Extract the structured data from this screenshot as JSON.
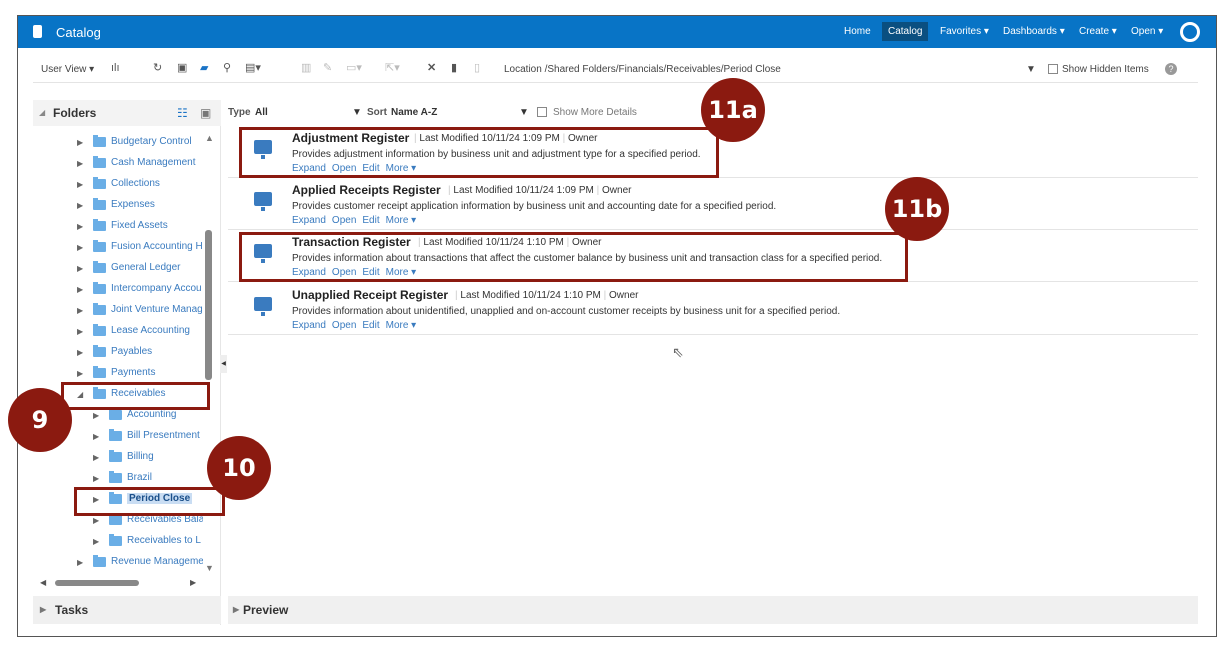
{
  "header": {
    "title": "Catalog",
    "nav": [
      "Home",
      "Catalog",
      "Favorites ▾",
      "Dashboards ▾",
      "Create ▾",
      "Open ▾"
    ],
    "active": "Catalog"
  },
  "toolbar": {
    "user_view": "User View ▾",
    "location": "Location /Shared Folders/Financials/Receivables/Period Close",
    "show_hidden": "Show Hidden Items"
  },
  "folders": {
    "title": "Folders",
    "items": [
      {
        "label": "Budgetary Control",
        "level": 1
      },
      {
        "label": "Cash Management",
        "level": 1
      },
      {
        "label": "Collections",
        "level": 1
      },
      {
        "label": "Expenses",
        "level": 1
      },
      {
        "label": "Fixed Assets",
        "level": 1
      },
      {
        "label": "Fusion Accounting H",
        "level": 1
      },
      {
        "label": "General Ledger",
        "level": 1
      },
      {
        "label": "Intercompany Accou",
        "level": 1
      },
      {
        "label": "Joint Venture Manag",
        "level": 1
      },
      {
        "label": "Lease Accounting",
        "level": 1
      },
      {
        "label": "Payables",
        "level": 1
      },
      {
        "label": "Payments",
        "level": 1
      },
      {
        "label": "Receivables",
        "level": 1,
        "expanded": true
      },
      {
        "label": "Accounting",
        "level": 2
      },
      {
        "label": "Bill Presentment",
        "level": 2
      },
      {
        "label": "Billing",
        "level": 2
      },
      {
        "label": "Brazil",
        "level": 2
      },
      {
        "label": "Period Close",
        "level": 2,
        "selected": true
      },
      {
        "label": "Receivables Bala",
        "level": 2
      },
      {
        "label": "Receivables to L",
        "level": 2
      },
      {
        "label": "Revenue Manageme",
        "level": 1
      }
    ]
  },
  "filter": {
    "type_label": "Type",
    "type_value": "All",
    "sort_label": "Sort",
    "sort_value": "Name A-Z",
    "show_more": "Show More Details"
  },
  "items": [
    {
      "name": "Adjustment Register",
      "modified": "Last Modified 10/11/24 1:09 PM",
      "owner": "Owner",
      "desc": "Provides adjustment information by business unit and adjustment type for a specified period."
    },
    {
      "name": "Applied Receipts Register",
      "modified": "Last Modified 10/11/24 1:09 PM",
      "owner": "Owner",
      "desc": "Provides customer receipt application information by business unit and accounting date for a specified period."
    },
    {
      "name": "Transaction Register",
      "modified": "Last Modified 10/11/24 1:10 PM",
      "owner": "Owner",
      "desc": "Provides information about transactions that affect the customer balance by business unit and transaction class for a specified period."
    },
    {
      "name": "Unapplied Receipt Register",
      "modified": "Last Modified 10/11/24 1:10 PM",
      "owner": "Owner",
      "desc": "Provides information about unidentified, unapplied and on-account customer receipts by business unit for a specified period."
    }
  ],
  "actions": {
    "expand": "Expand",
    "open": "Open",
    "edit": "Edit",
    "more": "More ▾"
  },
  "panels": {
    "tasks": "Tasks",
    "preview": "Preview"
  },
  "annotations": {
    "a9": "9",
    "a10": "10",
    "a11a": "11a",
    "a11b": "11b"
  }
}
